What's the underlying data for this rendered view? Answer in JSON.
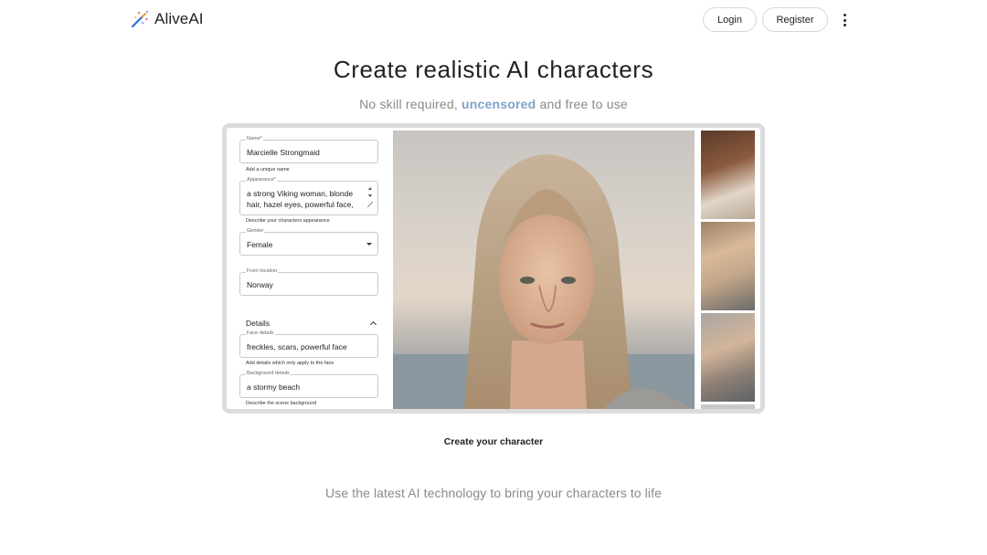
{
  "header": {
    "brand": "AliveAI",
    "login_label": "Login",
    "register_label": "Register"
  },
  "hero": {
    "title": "Create realistic AI characters",
    "subtitle_before": "No skill required,",
    "subtitle_accent": "uncensored",
    "subtitle_after": "and free to use"
  },
  "form": {
    "name_label": "Name*",
    "name_value": "Marcielle Strongmaid",
    "name_help": "Add a unique name",
    "appearance_label": "Appearance*",
    "appearance_line1": "a strong Viking woman, blonde",
    "appearance_line2": "hair, hazel eyes, powerful face,",
    "appearance_help": "Describe your characters appearance",
    "gender_label": "Gender",
    "gender_value": "Female",
    "location_label": "From location",
    "location_value": "Norway",
    "details_title": "Details",
    "face_label": "Face details",
    "face_value": "freckles, scars, powerful face",
    "face_help": "Add details which only apply to the face",
    "background_label": "Background details",
    "background_value": "a stormy beach",
    "background_help": "Describe the scene background"
  },
  "cta_label": "Create your character",
  "tagline": "Use the latest AI technology to bring your characters to life",
  "colors": {
    "accent": "#7fa4c6",
    "muted_text": "#8a8a8a",
    "frame_border": "#dcdcdc",
    "wand_blue": "#2f6fd6",
    "wand_tip": "#f2a23a"
  },
  "icons": {
    "logo": "magic-wand-icon",
    "menu": "kebab-menu-icon",
    "gender_dropdown": "chevron-down-icon",
    "details_toggle": "chevron-up-icon"
  }
}
